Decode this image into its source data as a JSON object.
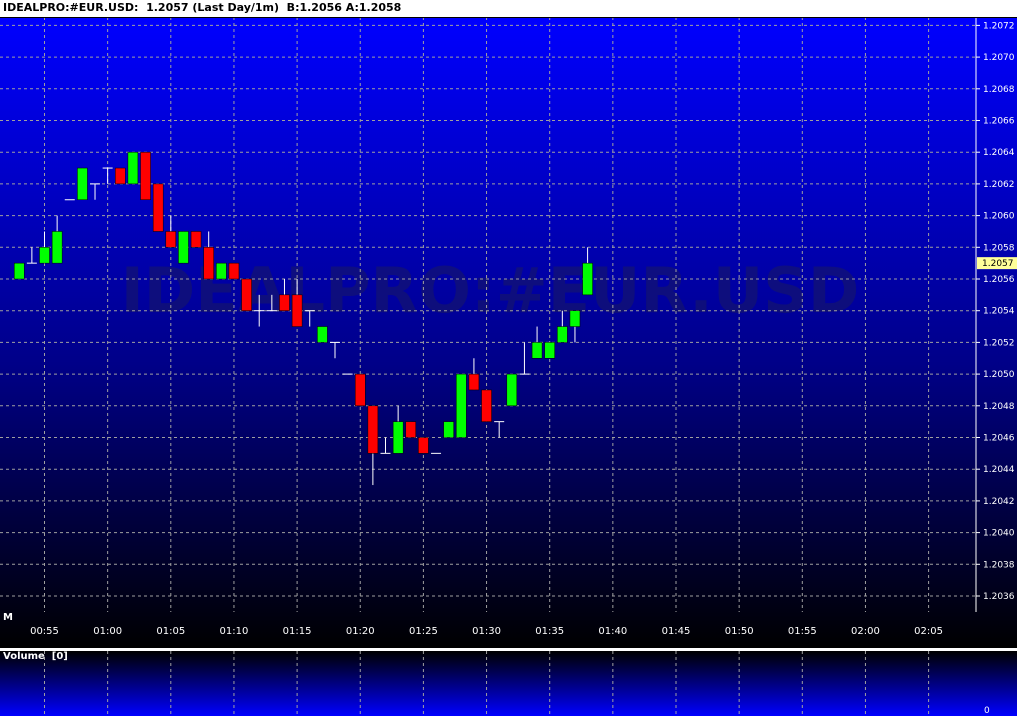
{
  "header": {
    "title": "IDEALPRO:#EUR.USD:  1.2057 (Last Day/1m)  B:1.2056 A:1.2058"
  },
  "period_label": "M",
  "volume_panel": {
    "label": "Volume  [0]",
    "zero_tick": "0"
  },
  "watermark": "IDEALPRO:#EUR.USD",
  "colors": {
    "background_top": "#0000ff",
    "background_bottom": "#000000",
    "up_candle": "#00ff00",
    "down_candle": "#ff0000",
    "grid": "#a0a0a0",
    "last_price_tag": "#ffff99"
  },
  "chart_data": {
    "type": "candlestick",
    "title": "IDEALPRO:#EUR.USD:  1.2057 (Last Day/1m)  B:1.2056 A:1.2058",
    "x_ticks": [
      "00:55",
      "01:00",
      "01:05",
      "01:10",
      "01:15",
      "01:20",
      "01:25",
      "01:30",
      "01:35",
      "01:40",
      "01:45",
      "01:50",
      "01:55",
      "02:00",
      "02:05"
    ],
    "y_ticks": [
      "1.2036",
      "1.2038",
      "1.2040",
      "1.2042",
      "1.2044",
      "1.2046",
      "1.2048",
      "1.2050",
      "1.2052",
      "1.2054",
      "1.2056",
      "1.2058",
      "1.2060",
      "1.2062",
      "1.2064",
      "1.2066",
      "1.2068",
      "1.2070",
      "1.2072"
    ],
    "ylim": [
      1.2034,
      1.2072
    ],
    "last_price": "1.2057",
    "grid": true,
    "candles": [
      {
        "t": "00:53",
        "o": 1.2056,
        "h": 1.2057,
        "l": 1.2056,
        "c": 1.2057
      },
      {
        "t": "00:54",
        "o": 1.2057,
        "h": 1.2058,
        "l": 1.2057,
        "c": 1.2057
      },
      {
        "t": "00:55",
        "o": 1.2057,
        "h": 1.2059,
        "l": 1.2057,
        "c": 1.2058
      },
      {
        "t": "00:56",
        "o": 1.2057,
        "h": 1.206,
        "l": 1.2057,
        "c": 1.2059
      },
      {
        "t": "00:57",
        "o": 1.2061,
        "h": 1.2061,
        "l": 1.2061,
        "c": 1.2061
      },
      {
        "t": "00:58",
        "o": 1.2061,
        "h": 1.2063,
        "l": 1.2061,
        "c": 1.2063
      },
      {
        "t": "00:59",
        "o": 1.2062,
        "h": 1.2062,
        "l": 1.2061,
        "c": 1.2062
      },
      {
        "t": "01:00",
        "o": 1.2063,
        "h": 1.2063,
        "l": 1.2062,
        "c": 1.2063
      },
      {
        "t": "01:01",
        "o": 1.2063,
        "h": 1.2063,
        "l": 1.2062,
        "c": 1.2062
      },
      {
        "t": "01:02",
        "o": 1.2062,
        "h": 1.2064,
        "l": 1.2062,
        "c": 1.2064
      },
      {
        "t": "01:03",
        "o": 1.2064,
        "h": 1.2064,
        "l": 1.2061,
        "c": 1.2061
      },
      {
        "t": "01:04",
        "o": 1.2062,
        "h": 1.2062,
        "l": 1.2059,
        "c": 1.2059
      },
      {
        "t": "01:05",
        "o": 1.2059,
        "h": 1.206,
        "l": 1.2058,
        "c": 1.2058
      },
      {
        "t": "01:06",
        "o": 1.2057,
        "h": 1.2059,
        "l": 1.2057,
        "c": 1.2059
      },
      {
        "t": "01:07",
        "o": 1.2059,
        "h": 1.2059,
        "l": 1.2058,
        "c": 1.2058
      },
      {
        "t": "01:08",
        "o": 1.2058,
        "h": 1.2059,
        "l": 1.2056,
        "c": 1.2056
      },
      {
        "t": "01:09",
        "o": 1.2056,
        "h": 1.2057,
        "l": 1.2056,
        "c": 1.2057
      },
      {
        "t": "01:10",
        "o": 1.2057,
        "h": 1.2057,
        "l": 1.2056,
        "c": 1.2056
      },
      {
        "t": "01:11",
        "o": 1.2056,
        "h": 1.2056,
        "l": 1.2054,
        "c": 1.2054
      },
      {
        "t": "01:12",
        "o": 1.2054,
        "h": 1.2055,
        "l": 1.2053,
        "c": 1.2054
      },
      {
        "t": "01:13",
        "o": 1.2054,
        "h": 1.2055,
        "l": 1.2054,
        "c": 1.2054
      },
      {
        "t": "01:14",
        "o": 1.2055,
        "h": 1.2056,
        "l": 1.2054,
        "c": 1.2054
      },
      {
        "t": "01:15",
        "o": 1.2055,
        "h": 1.2056,
        "l": 1.2053,
        "c": 1.2053
      },
      {
        "t": "01:16",
        "o": 1.2054,
        "h": 1.2054,
        "l": 1.2053,
        "c": 1.2054
      },
      {
        "t": "01:17",
        "o": 1.2052,
        "h": 1.2053,
        "l": 1.2052,
        "c": 1.2053
      },
      {
        "t": "01:18",
        "o": 1.2052,
        "h": 1.2052,
        "l": 1.2051,
        "c": 1.2052
      },
      {
        "t": "01:19",
        "o": 1.205,
        "h": 1.205,
        "l": 1.205,
        "c": 1.205
      },
      {
        "t": "01:20",
        "o": 1.205,
        "h": 1.205,
        "l": 1.2048,
        "c": 1.2048
      },
      {
        "t": "01:21",
        "o": 1.2048,
        "h": 1.2048,
        "l": 1.2043,
        "c": 1.2045
      },
      {
        "t": "01:22",
        "o": 1.2045,
        "h": 1.2046,
        "l": 1.2045,
        "c": 1.2045
      },
      {
        "t": "01:23",
        "o": 1.2045,
        "h": 1.2048,
        "l": 1.2045,
        "c": 1.2047
      },
      {
        "t": "01:24",
        "o": 1.2047,
        "h": 1.2047,
        "l": 1.2046,
        "c": 1.2046
      },
      {
        "t": "01:25",
        "o": 1.2046,
        "h": 1.2046,
        "l": 1.2045,
        "c": 1.2045
      },
      {
        "t": "01:26",
        "o": 1.2045,
        "h": 1.2045,
        "l": 1.2045,
        "c": 1.2045
      },
      {
        "t": "01:27",
        "o": 1.2046,
        "h": 1.2047,
        "l": 1.2046,
        "c": 1.2047
      },
      {
        "t": "01:28",
        "o": 1.2046,
        "h": 1.205,
        "l": 1.2046,
        "c": 1.205
      },
      {
        "t": "01:29",
        "o": 1.205,
        "h": 1.2051,
        "l": 1.2049,
        "c": 1.2049
      },
      {
        "t": "01:30",
        "o": 1.2049,
        "h": 1.2049,
        "l": 1.2047,
        "c": 1.2047
      },
      {
        "t": "01:31",
        "o": 1.2047,
        "h": 1.2047,
        "l": 1.2046,
        "c": 1.2047
      },
      {
        "t": "01:32",
        "o": 1.2048,
        "h": 1.205,
        "l": 1.2048,
        "c": 1.205
      },
      {
        "t": "01:33",
        "o": 1.205,
        "h": 1.2052,
        "l": 1.205,
        "c": 1.205
      },
      {
        "t": "01:34",
        "o": 1.2051,
        "h": 1.2053,
        "l": 1.2051,
        "c": 1.2052
      },
      {
        "t": "01:35",
        "o": 1.2051,
        "h": 1.2052,
        "l": 1.2051,
        "c": 1.2052
      },
      {
        "t": "01:36",
        "o": 1.2052,
        "h": 1.2054,
        "l": 1.2052,
        "c": 1.2053
      },
      {
        "t": "01:37",
        "o": 1.2053,
        "h": 1.2054,
        "l": 1.2052,
        "c": 1.2054
      },
      {
        "t": "01:38",
        "o": 1.2055,
        "h": 1.2058,
        "l": 1.2055,
        "c": 1.2057
      }
    ]
  }
}
